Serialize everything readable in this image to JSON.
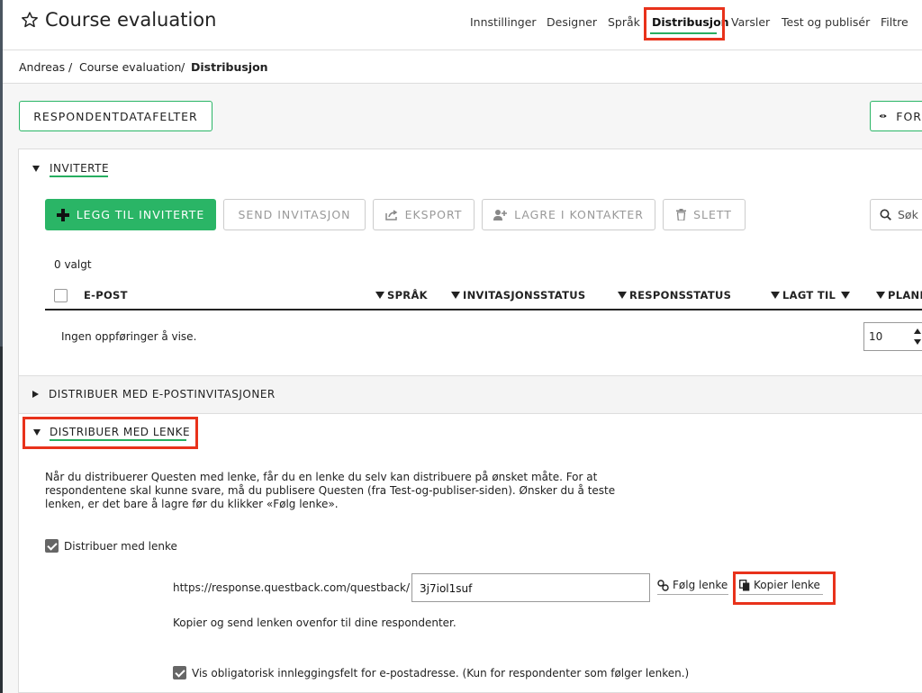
{
  "header": {
    "title": "Course evaluation",
    "nav": [
      "Innstillinger",
      "Designer",
      "Språk",
      "Distribusjon",
      "Varsler",
      "Test og publisér",
      "Filtre"
    ],
    "active_nav": "Distribusjon"
  },
  "breadcrumb": [
    "Andreas",
    "Course evaluation",
    "Distribusjon"
  ],
  "toolbar": {
    "respondent_fields_label": "RESPONDENTDATAFELTER",
    "preview_label": "FOR"
  },
  "invitees": {
    "section_label": "INVITERTE",
    "buttons": {
      "add": "LEGG TIL INVITERTE",
      "send": "SEND INVITASJON",
      "export": "EKSPORT",
      "save_contacts": "LAGRE I KONTAKTER",
      "delete": "SLETT"
    },
    "search_placeholder": "Søk",
    "selected_count": "0 valgt",
    "columns": [
      "E-POST",
      "SPRÅK",
      "INVITASJONSSTATUS",
      "RESPONSSTATUS",
      "LAGT TIL",
      "PLANL"
    ],
    "empty_message": "Ingen oppføringer å vise.",
    "page_size": "10"
  },
  "email_section": {
    "label": "DISTRIBUER MED E-POSTINVITASJONER"
  },
  "link_section": {
    "label": "DISTRIBUER MED LENKE",
    "description": "Når du distribuerer Questen med lenke, får du en lenke du selv kan distribuere på ønsket måte. For at respondentene skal kunne svare, må du publisere Questen (fra Test-og-publiser-siden). Ønsker du å teste lenken, er det bare å lagre før du klikker «Følg lenke».",
    "distribute_checkbox_label": "Distribuer med lenke",
    "distribute_checked": true,
    "url_prefix": "https://response.questback.com/questback/",
    "url_slug": "3j7iol1suf",
    "follow_link_label": "Følg lenke",
    "copy_link_label": "Kopier lenke",
    "copy_hint": "Kopier og send lenken ovenfor til dine respondenter.",
    "email_field_checkbox_label": "Vis obligatorisk innleggingsfelt for e-postadresse. (Kun for respondenter som følger lenken.)",
    "email_field_checked": true
  },
  "colors": {
    "accent_green": "#2ab566",
    "highlight_red": "#e8321b"
  }
}
